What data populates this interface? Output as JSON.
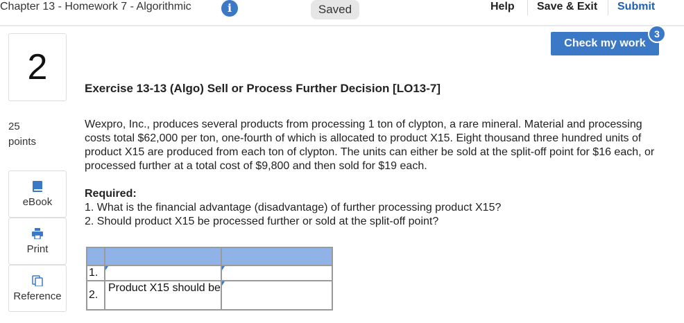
{
  "header": {
    "chapter_title": "Chapter 13 - Homework 7 - Algorithmic",
    "info_glyph": "i",
    "saved_label": "Saved",
    "help_label": "Help",
    "save_exit_label": "Save & Exit",
    "submit_label": "Submit"
  },
  "question": {
    "number": "2",
    "points_value": "25",
    "points_label": "points"
  },
  "sidebar": {
    "buttons": [
      {
        "label": "eBook",
        "icon": "book-icon"
      },
      {
        "label": "Print",
        "icon": "print-icon"
      },
      {
        "label": "Reference",
        "icon": "reference-icon"
      }
    ]
  },
  "check": {
    "label": "Check my work",
    "badge": "3"
  },
  "exercise": {
    "title": "Exercise 13-13 (Algo) Sell or Process Further Decision [LO13-7]",
    "paragraph": "Wexpro, Inc., produces several products from processing 1 ton of clypton, a rare mineral. Material and processing costs total $62,000 per ton, one-fourth of which is allocated to product X15. Eight thousand three hundred units of product X15 are produced from each ton of clypton. The units can either be sold at the split-off point for $16 each, or processed further at a total cost of $9,800 and then sold for $19 each.",
    "required_heading": "Required:",
    "requirements": [
      "1. What is the financial advantage (disadvantage) of further processing product X15?",
      "2. Should product X15 be processed further or sold at the split-off point?"
    ]
  },
  "answer_table": {
    "rows": [
      {
        "num": "1.",
        "label": "",
        "value": ""
      },
      {
        "num": "2.",
        "label": "Product X15 should be",
        "value": ""
      }
    ]
  },
  "colors": {
    "accent": "#3b78c6",
    "table_header": "#8fb3e6"
  }
}
